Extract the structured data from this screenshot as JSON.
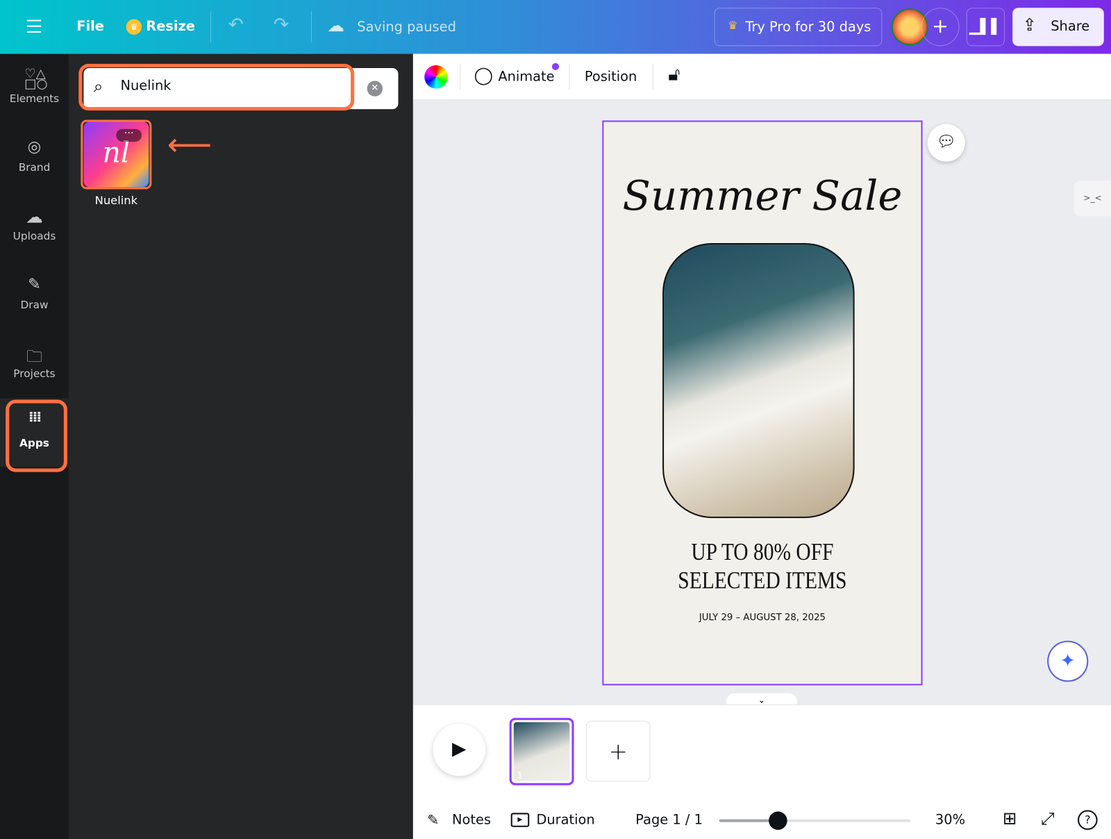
{
  "topbar": {
    "menu_icon": "hamburger-icon",
    "file": "File",
    "resize": "Resize",
    "saving": "Saving paused",
    "try_pro": "Try Pro for 30 days",
    "share": "Share",
    "colors": {
      "gradient_start": "#00c4cc",
      "gradient_end": "#7d2ae8"
    }
  },
  "rail": {
    "items": [
      {
        "label": "Elements",
        "icon": "shapes-icon"
      },
      {
        "label": "Brand",
        "icon": "brand-icon"
      },
      {
        "label": "Uploads",
        "icon": "cloud-upload-icon"
      },
      {
        "label": "Draw",
        "icon": "pen-icon"
      },
      {
        "label": "Projects",
        "icon": "folder-icon"
      },
      {
        "label": "Apps",
        "icon": "grid-icon",
        "active": true
      }
    ]
  },
  "panel": {
    "search_value": "Nuelink",
    "search_placeholder": "Search",
    "results": [
      {
        "name": "Nuelink",
        "logo_text": "nl"
      }
    ]
  },
  "context_toolbar": {
    "animate": "Animate",
    "position": "Position"
  },
  "design": {
    "title": "Summer Sale",
    "headline1": "UP TO 80% OFF",
    "headline2": "SELECTED ITEMS",
    "dates": "JULY 29 – AUGUST 28, 2025"
  },
  "bottom": {
    "notes": "Notes",
    "duration": "Duration",
    "page": "Page 1 / 1",
    "zoom": "30%",
    "zoom_percent": 30,
    "thumb_number": "1"
  },
  "annotation_color": "#ff7043",
  "accent": "#8b3dff"
}
